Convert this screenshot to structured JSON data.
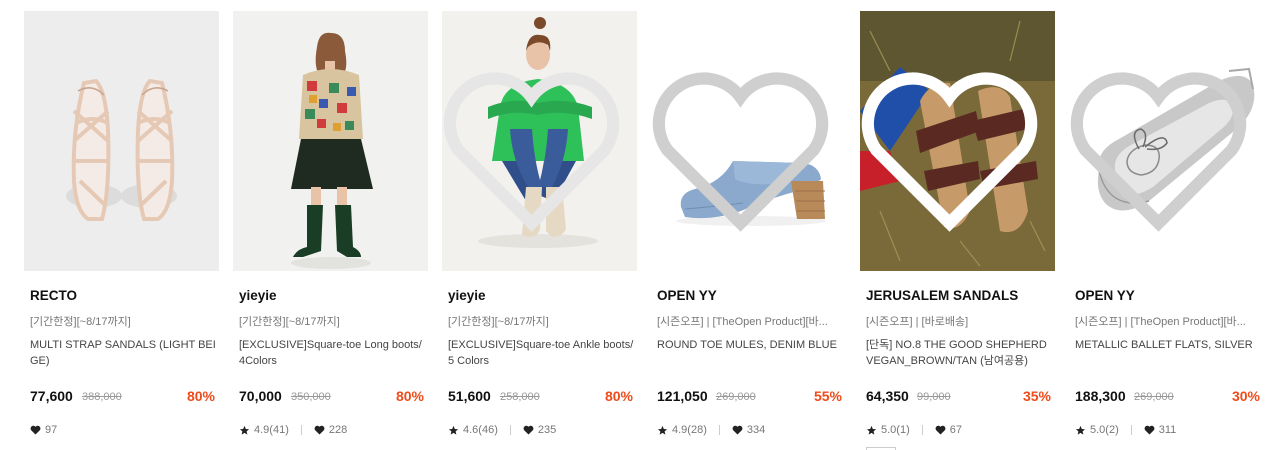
{
  "products": [
    {
      "brand": "RECTO",
      "promo": "[기간한정][~8/17까지]",
      "name": "MULTI STRAP SANDALS (LIGHT BEIGE)",
      "price": "77,600",
      "original_price": "388,000",
      "discount": "80%",
      "likes": "97"
    },
    {
      "brand": "yieyie",
      "promo": "[기간한정][~8/17까지]",
      "name": "[EXCLUSIVE]Square-toe Long boots/ 4Colors",
      "price": "70,000",
      "original_price": "350,000",
      "discount": "80%",
      "rating": "4.9(41)",
      "likes": "228"
    },
    {
      "brand": "yieyie",
      "promo": "[기간한정][~8/17까지]",
      "name": "[EXCLUSIVE]Square-toe Ankle boots/ 5 Colors",
      "price": "51,600",
      "original_price": "258,000",
      "discount": "80%",
      "rating": "4.6(46)",
      "likes": "235"
    },
    {
      "brand": "OPEN YY",
      "promo": "[시즌오프] | [TheOpen Product][바...",
      "name": "ROUND TOE MULES, DENIM BLUE",
      "price": "121,050",
      "original_price": "269,000",
      "discount": "55%",
      "rating": "4.9(28)",
      "likes": "334"
    },
    {
      "brand": "JERUSALEM SANDALS",
      "promo": "[시즌오프] | [바로배송]",
      "name": "[단독] NO.8 THE GOOD SHEPHERD VEGAN_BROWN/TAN (남여공용)",
      "price": "64,350",
      "original_price": "99,000",
      "discount": "35%",
      "rating": "5.0(1)",
      "likes": "67"
    },
    {
      "brand": "OPEN YY",
      "promo": "[시즌오프] | [TheOpen Product][바...",
      "name": "METALLIC BALLET FLATS, SILVER",
      "price": "188,300",
      "original_price": "269,000",
      "discount": "30%",
      "rating": "5.0(2)",
      "likes": "311"
    }
  ],
  "colors": {
    "discount": "#f04b1a",
    "price": "#111111",
    "muted": "#999999"
  },
  "icons": {
    "wishlist": "heart-outline-icon",
    "rating": "star-icon",
    "likes": "heart-filled-icon"
  }
}
